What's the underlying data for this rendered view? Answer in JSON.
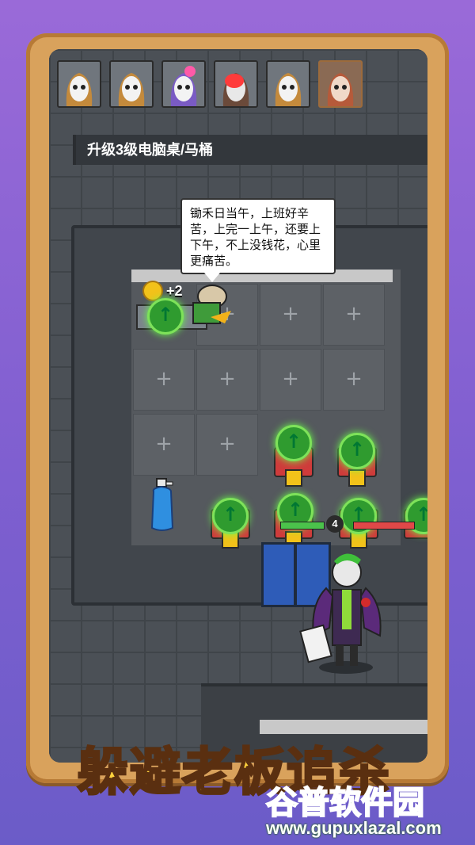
{
  "task": {
    "text": "升级3级电脑桌/马桶"
  },
  "speech": {
    "text": "锄禾日当午，上班好辛苦，上完一上午，还要上下午，不上没钱花，心里更痛苦。"
  },
  "reward": {
    "text": "+2"
  },
  "boss": {
    "level": "4"
  },
  "banner": {
    "title": "躲避老板追杀"
  },
  "watermark": {
    "name": "谷普软件园",
    "url": "www.gupuxlazal.com"
  },
  "colors": {
    "accent_green": "#7ee25a",
    "frame": "#d9a25c",
    "title_yellow": "#ffd23d"
  },
  "characters": [
    {
      "icon": "girl-avatar-icon"
    },
    {
      "icon": "girl-avatar-icon"
    },
    {
      "icon": "girl-bow-avatar-icon"
    },
    {
      "icon": "girl-mask-avatar-icon"
    },
    {
      "icon": "girl-avatar-icon"
    },
    {
      "icon": "girl-selected-avatar-icon"
    }
  ]
}
